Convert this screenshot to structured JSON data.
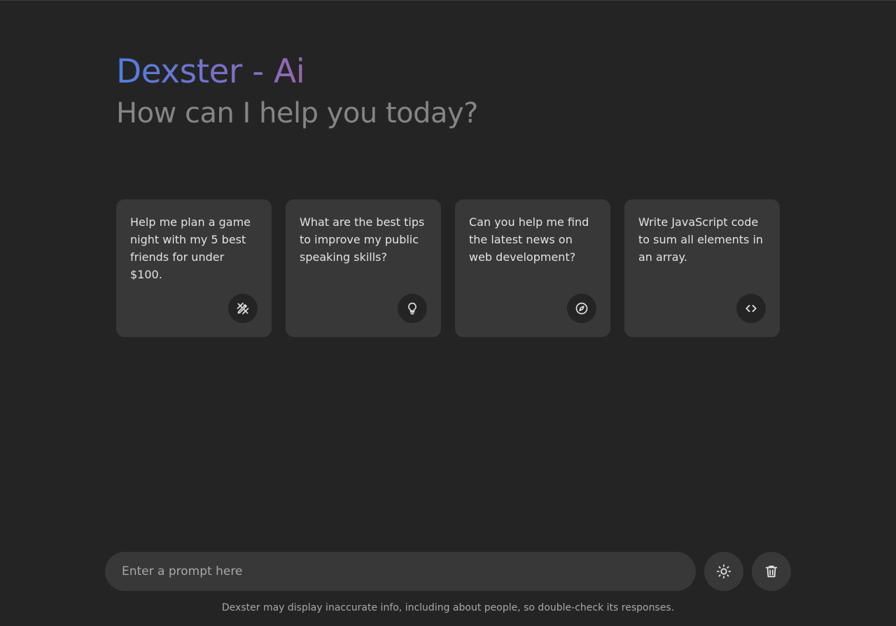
{
  "header": {
    "title": "Dexster - Ai",
    "subtitle": "How can I help you today?"
  },
  "suggestions": [
    {
      "text": "Help me plan a game night with my 5 best friends for under $100.",
      "icon": "pencil-ruler-icon"
    },
    {
      "text": "What are the best tips to improve my public speaking skills?",
      "icon": "lightbulb-icon"
    },
    {
      "text": "Can you help me find the latest news on web development?",
      "icon": "compass-icon"
    },
    {
      "text": "Write JavaScript code to sum all elements in an array.",
      "icon": "code-icon"
    }
  ],
  "prompt": {
    "placeholder": "Enter a prompt here",
    "value": ""
  },
  "actions": {
    "theme_icon": "sun-icon",
    "delete_icon": "trash-icon"
  },
  "footer": {
    "disclaimer": "Dexster may display inaccurate info, including about people, so double-check its responses."
  },
  "colors": {
    "background": "#242424",
    "card": "#383838",
    "title_gradient_start": "#4f7fe0",
    "title_gradient_end": "#c2586c"
  }
}
